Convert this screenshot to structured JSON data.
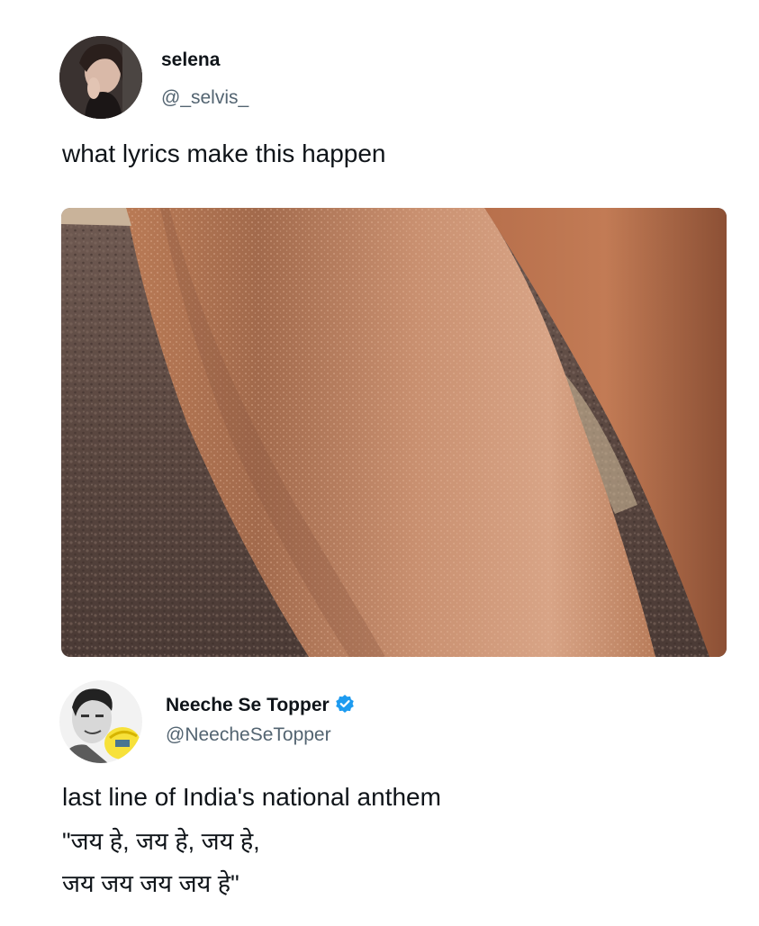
{
  "tweet": {
    "author": {
      "display_name": "selena",
      "handle": "@_selvis_",
      "avatar_icon": "profile-photo-icon"
    },
    "text": "what lyrics make this happen",
    "media": {
      "icon": "goosebumps-arm-photo"
    }
  },
  "reply": {
    "author": {
      "display_name": "Neeche Se Topper",
      "handle": "@NeecheSeTopper",
      "verified": true,
      "avatar_icon": "profile-photo-icon"
    },
    "lines": [
      "last line of India's national anthem",
      "\"जय हे, जय हे, जय हे,",
      "जय जय जय जय हे\""
    ]
  },
  "colors": {
    "text": "#0f1419",
    "secondary_text": "#536471",
    "verified_badge": "#1d9bf0"
  }
}
